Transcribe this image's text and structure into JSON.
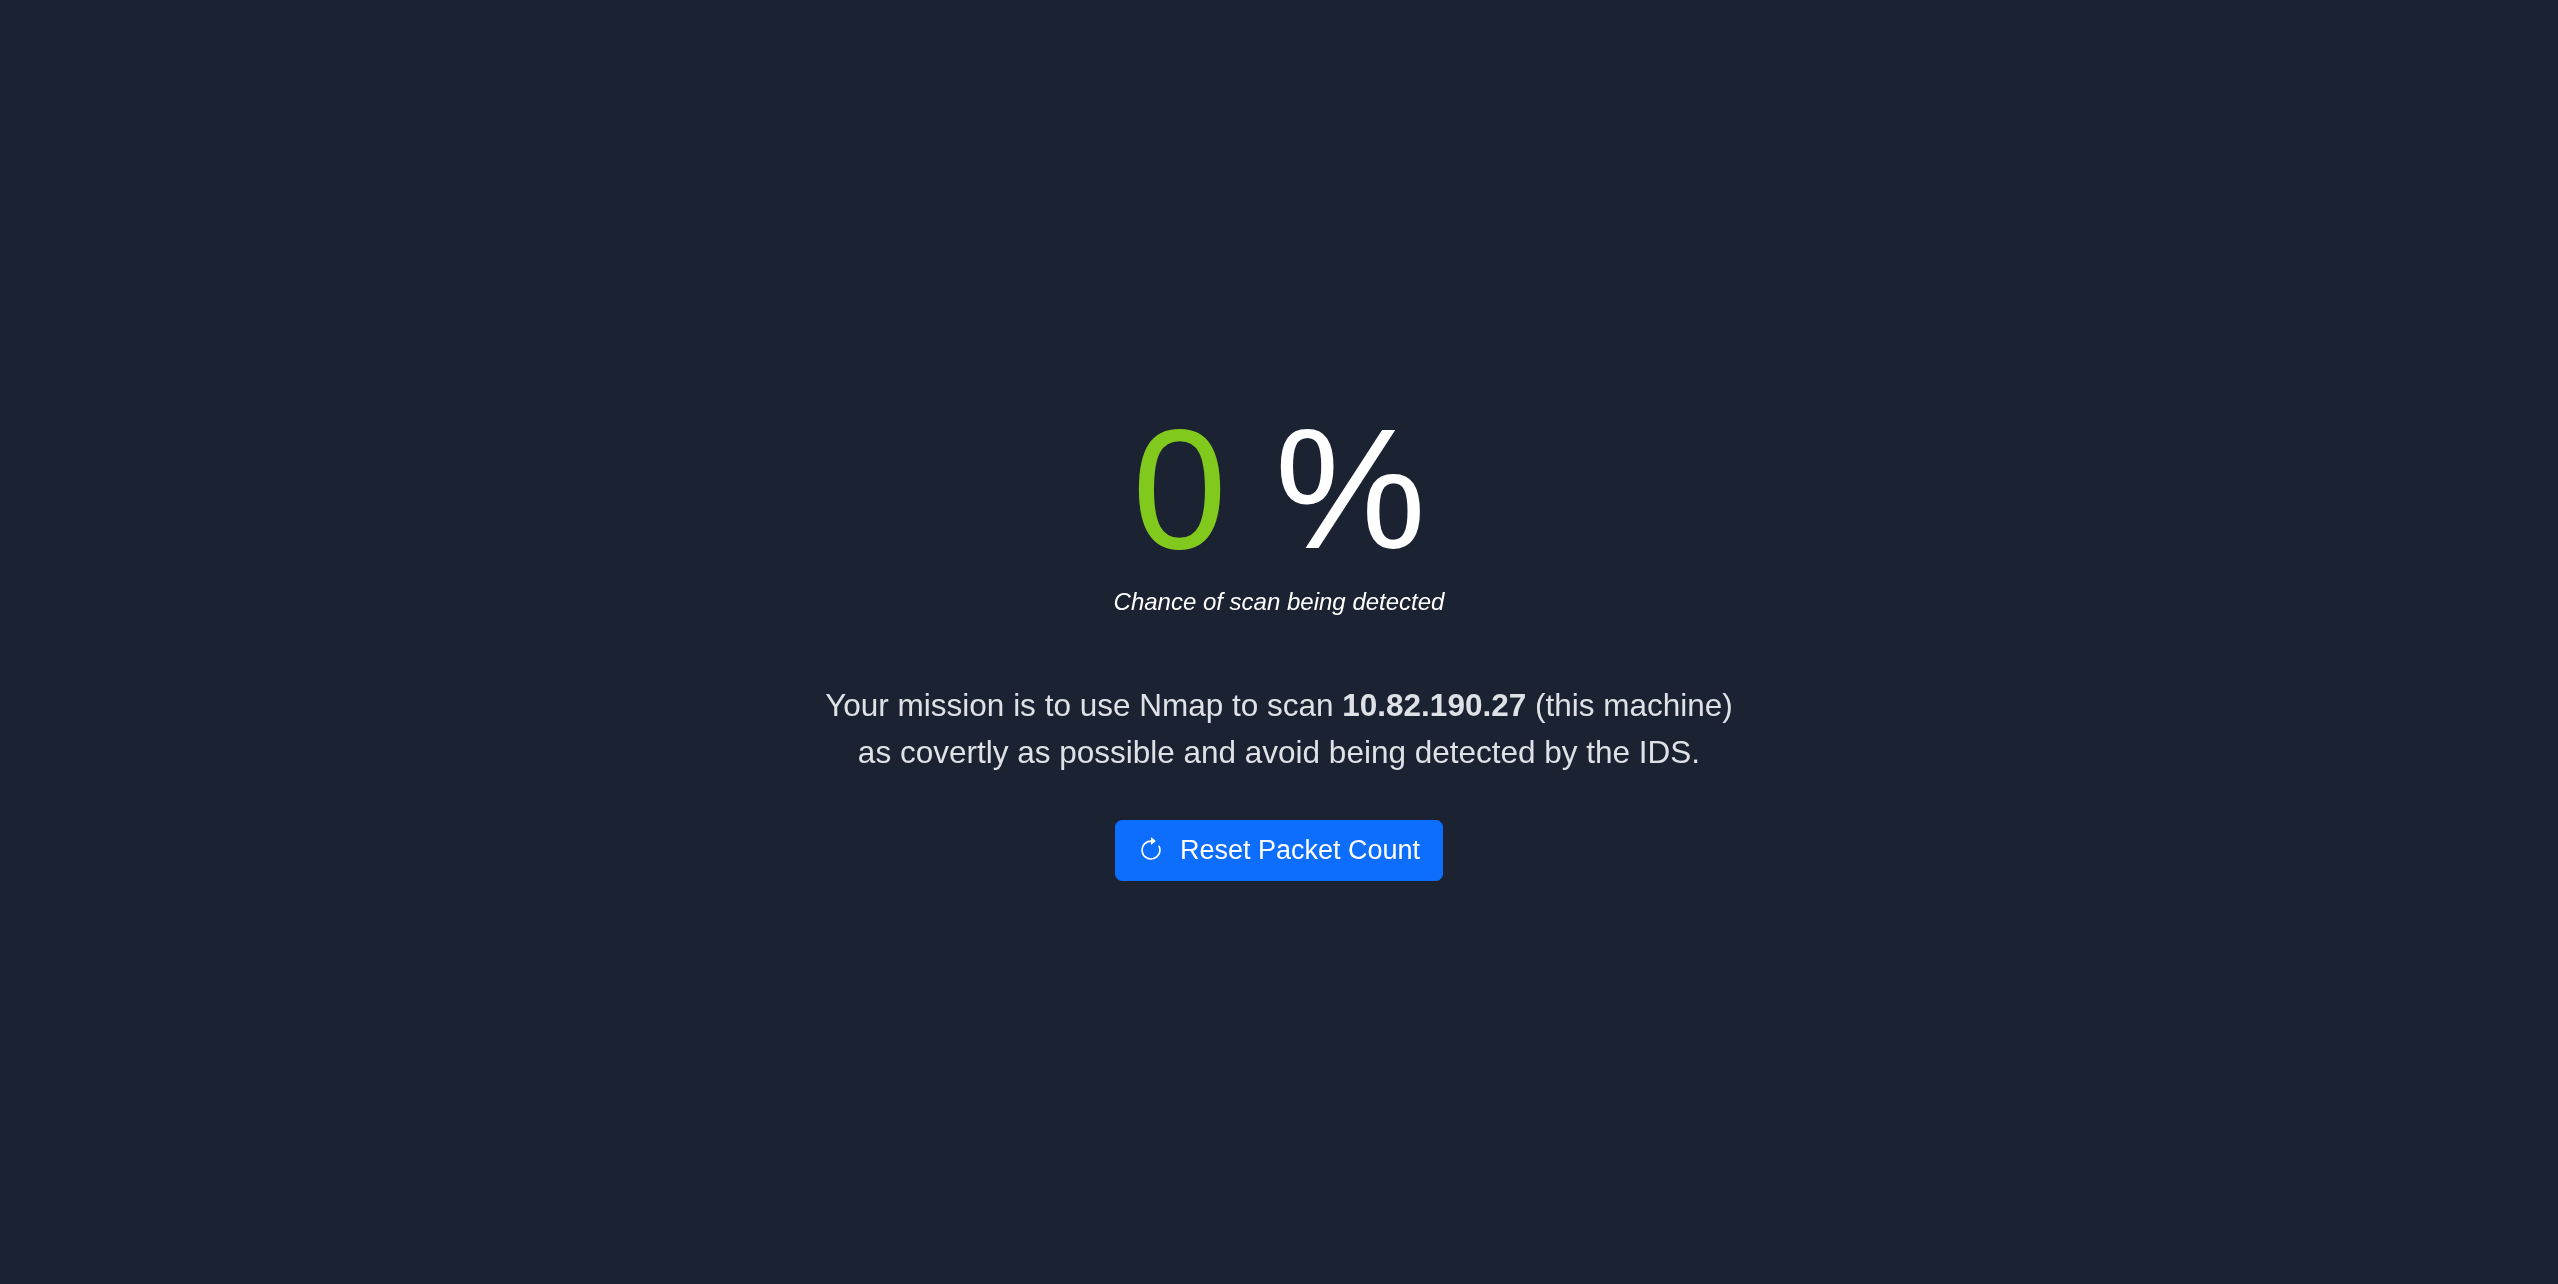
{
  "detection": {
    "value": "0",
    "unit": "%",
    "caption": "Chance of scan being detected"
  },
  "mission": {
    "lines": [
      "Your mission is to use Nmap to scan **10.82.190.27** (this machine)",
      "as covertly as possible and avoid being detected by the IDS."
    ]
  },
  "buttons": [
    {
      "label": "Reset Packet Count",
      "kind": "reset"
    }
  ]
}
